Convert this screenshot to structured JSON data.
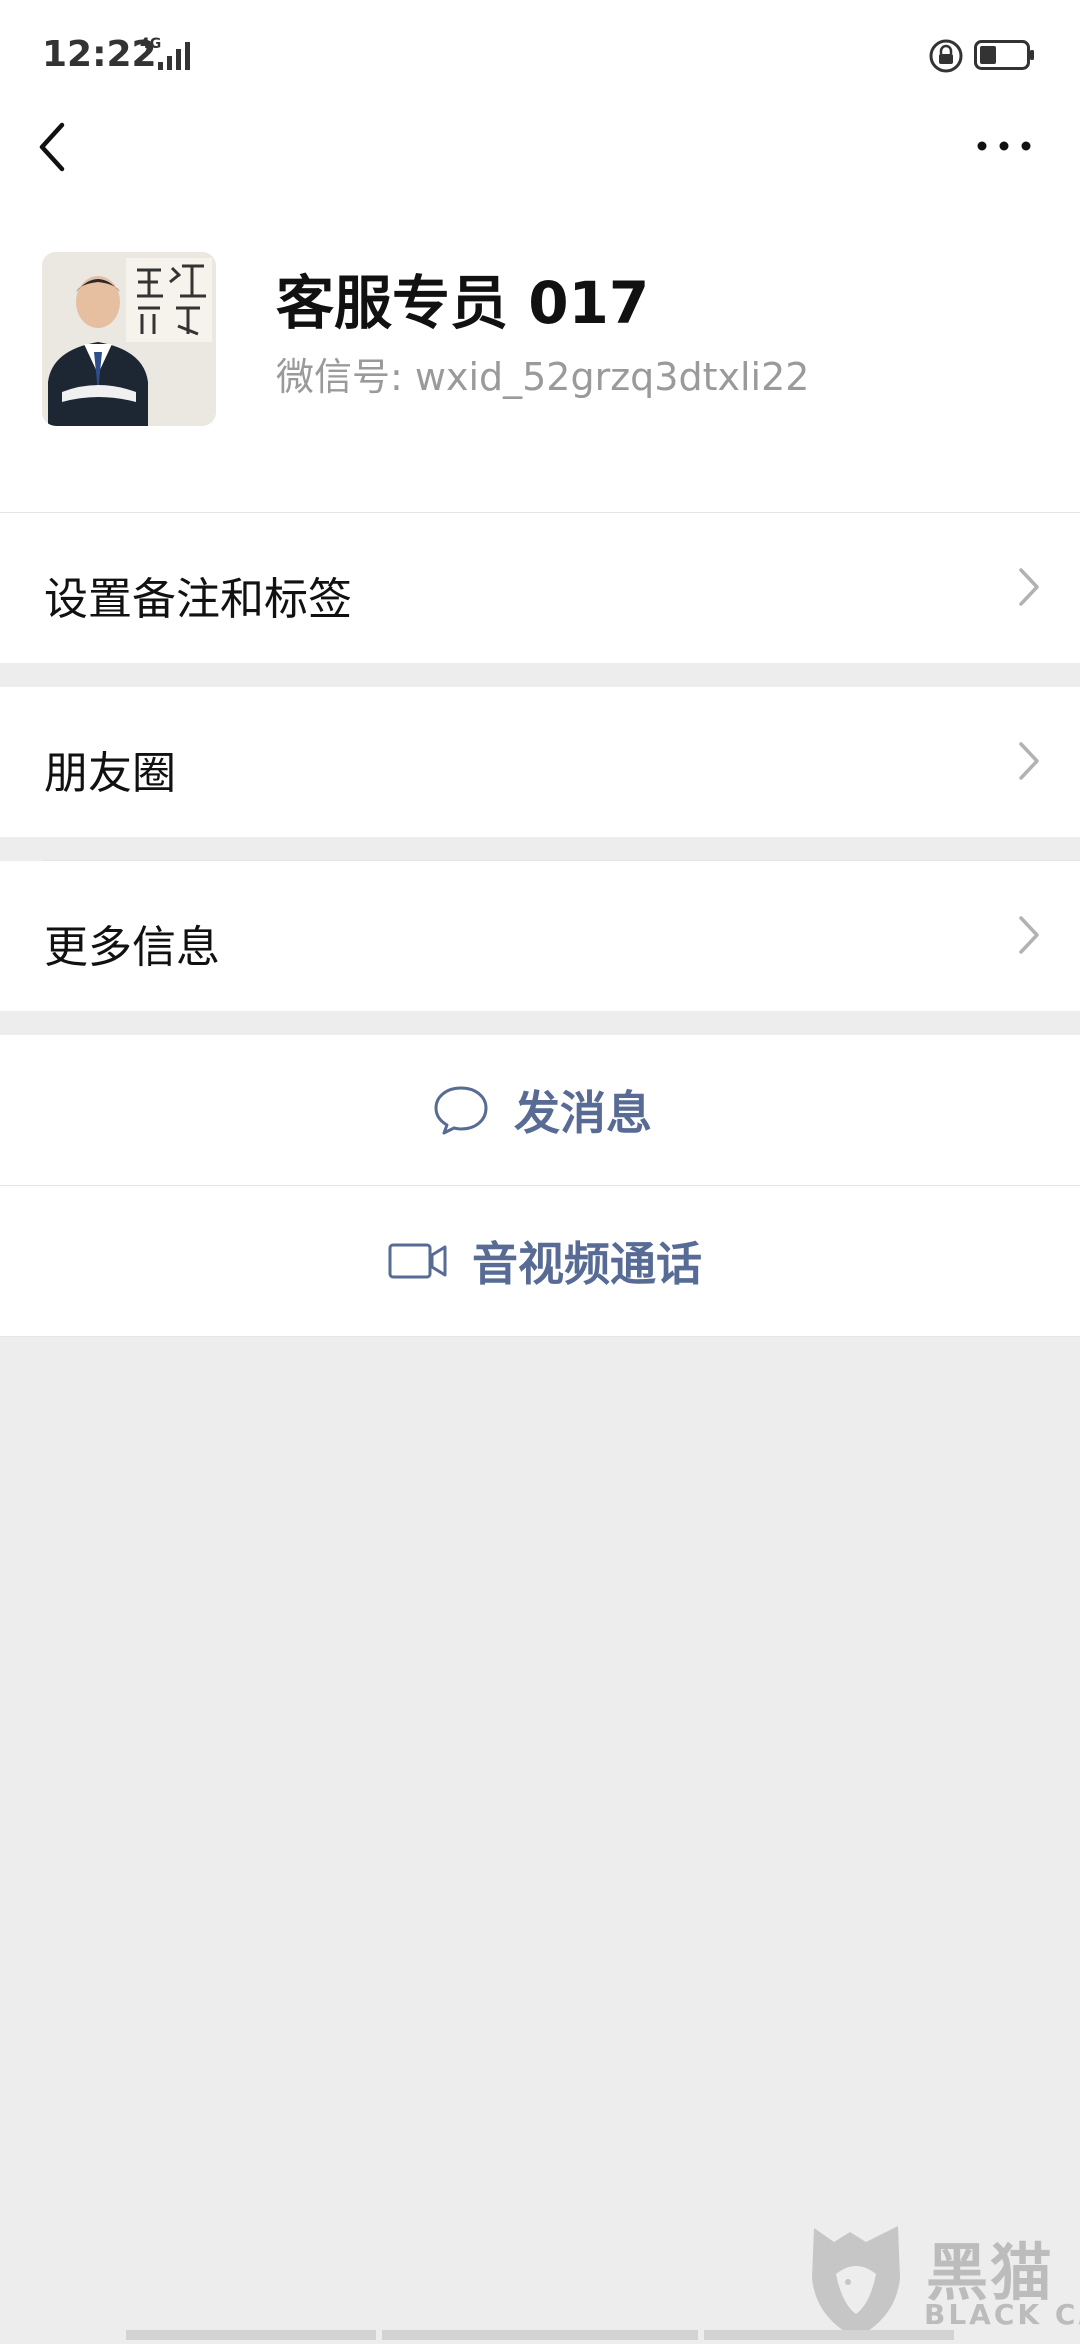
{
  "status_bar": {
    "time": "12:22",
    "network": "4G"
  },
  "profile": {
    "name": "客服专员 017",
    "wechat_id": "微信号: wxid_52grzq3dtxli22"
  },
  "cells": {
    "remarks_tags": "设置备注和标签",
    "moments": "朋友圈",
    "more_info": "更多信息"
  },
  "actions": {
    "send_message": "发消息",
    "video_call": "音视频通话"
  },
  "colors": {
    "link_blue": "#576b95",
    "background": "#ededed"
  },
  "watermark": {
    "brand_cn": "黑猫",
    "brand_en": "BLACK CAT"
  }
}
